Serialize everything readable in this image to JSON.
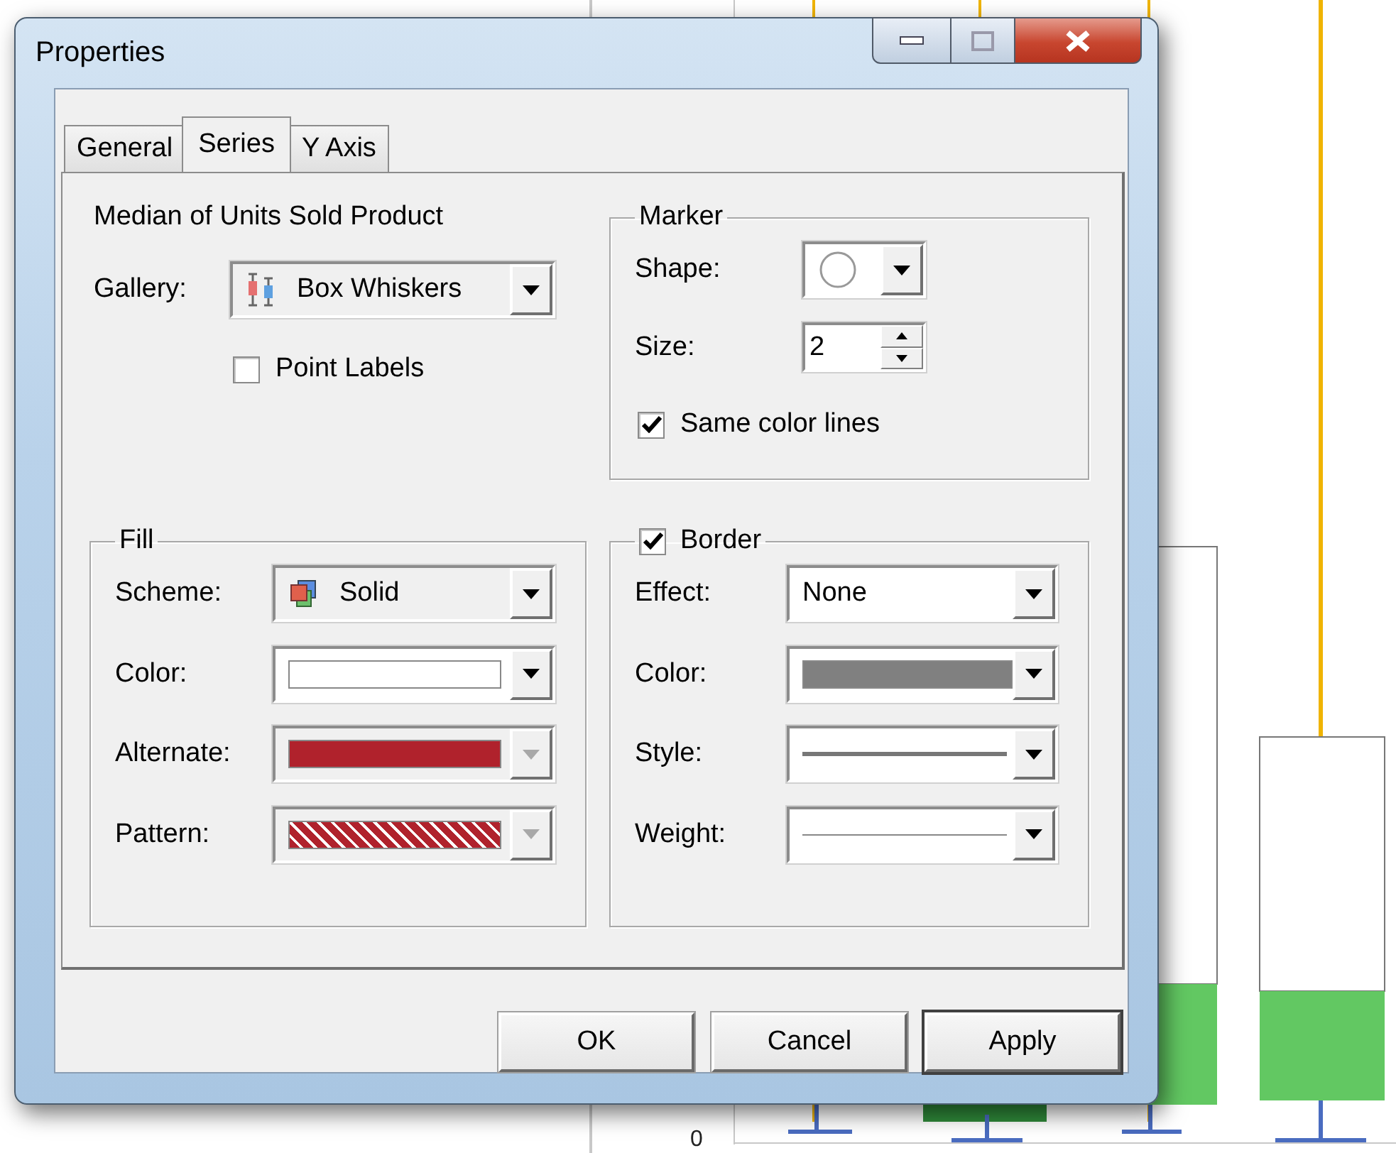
{
  "window": {
    "title": "Properties"
  },
  "tabs": [
    {
      "label": "General",
      "selected": false
    },
    {
      "label": "Series",
      "selected": true
    },
    {
      "label": "Y Axis",
      "selected": false
    }
  ],
  "series_name": "Median of Units Sold Product",
  "gallery": {
    "label": "Gallery:",
    "value": "Box Whiskers"
  },
  "point_labels": {
    "label": "Point Labels",
    "checked": false
  },
  "marker": {
    "title": "Marker",
    "shape": {
      "label": "Shape:",
      "kind": "circle"
    },
    "size": {
      "label": "Size:",
      "value": "2"
    },
    "same_color_lines": {
      "label": "Same color lines",
      "checked": true
    }
  },
  "fill": {
    "title": "Fill",
    "rows": [
      {
        "label": "Scheme:",
        "kind": "scheme",
        "value": "Solid",
        "disabled": false
      },
      {
        "label": "Color:",
        "kind": "swatch",
        "color": "#ffffff",
        "disabled": false
      },
      {
        "label": "Alternate:",
        "kind": "swatch",
        "color": "#b0222c",
        "disabled": true
      },
      {
        "label": "Pattern:",
        "kind": "pattern",
        "color": "#b0222c",
        "disabled": true
      }
    ]
  },
  "border": {
    "title": "Border",
    "checked": true,
    "rows": [
      {
        "label": "Effect:",
        "kind": "text",
        "value": "None",
        "disabled": false
      },
      {
        "label": "Color:",
        "kind": "swatch",
        "color": "#808080",
        "disabled": false
      },
      {
        "label": "Style:",
        "kind": "line",
        "disabled": false
      },
      {
        "label": "Weight:",
        "kind": "thin-line",
        "disabled": false
      }
    ]
  },
  "buttons": [
    {
      "label": "OK",
      "default": false
    },
    {
      "label": "Cancel",
      "default": false
    },
    {
      "label": "Apply",
      "default": true
    }
  ],
  "chart": {
    "y_tick_label": "0"
  }
}
